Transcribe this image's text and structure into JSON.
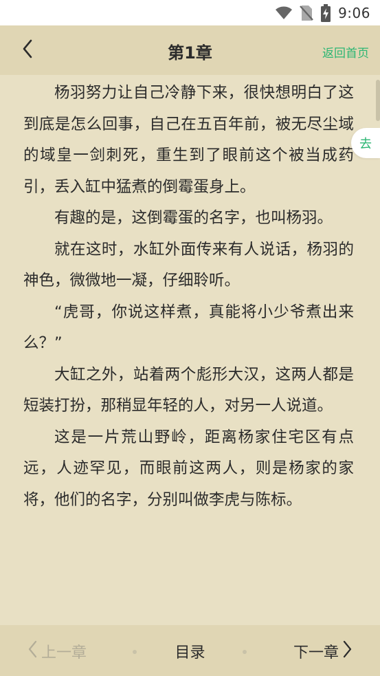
{
  "status_bar": {
    "time": "9:06",
    "icons": [
      "wifi-icon",
      "no-sim-icon",
      "battery-charging-icon"
    ]
  },
  "header": {
    "title": "第1章",
    "back_icon": "chevron-left-icon",
    "home_link": "返回首页"
  },
  "side_tab": {
    "label": "去"
  },
  "content": {
    "paragraphs": [
      "杨羽努力让自己冷静下来，很快想明白了这到底是怎么回事，自己在五百年前，被无尽尘域的域皇一剑刺死，重生到了眼前这个被当成药引，丢入缸中猛煮的倒霉蛋身上。",
      "有趣的是，这倒霉蛋的名字，也叫杨羽。",
      "就在这时，水缸外面传来有人说话，杨羽的神色，微微地一凝，仔细聆听。",
      "“虎哥，你说这样煮，真能将小少爷煮出来么？”",
      "大缸之外，站着两个彪形大汉，这两人都是短装打扮，那稍显年轻的人，对另一人说道。",
      "这是一片荒山野岭，距离杨家住宅区有点远，人迹罕见，而眼前这两人，则是杨家的家将，他们的名字，分别叫做李虎与陈标。"
    ]
  },
  "bottom_nav": {
    "prev_label": "上一章",
    "toc_label": "目录",
    "next_label": "下一章"
  },
  "colors": {
    "page_bg": "#e8e0c4",
    "bar_bg": "#e0d6b4",
    "accent": "#2bb673",
    "text": "#2b2b2b",
    "disabled": "#b3ad98"
  }
}
